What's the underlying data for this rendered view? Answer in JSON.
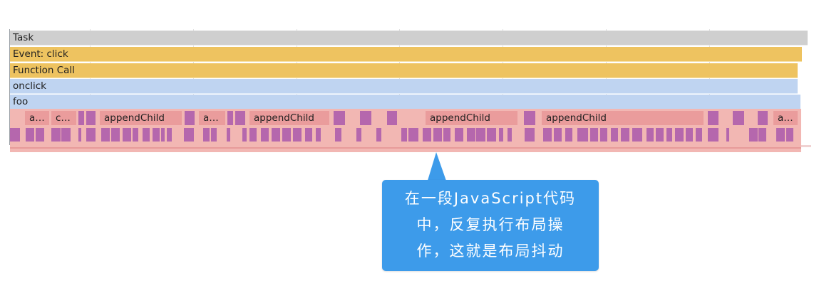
{
  "rows": {
    "task": "Task",
    "event": "Event: click",
    "function_call": "Function Call",
    "onclick": "onclick",
    "foo": "foo"
  },
  "call_labels": {
    "a1": "a…",
    "c1": "c…",
    "append1": "appendChild",
    "a2": "a…",
    "append2": "appendChild",
    "append3": "appendChild",
    "append4": "appendChild",
    "a3": "a…"
  },
  "callout": {
    "line1": "在一段JavaScript代码",
    "line2": "中，反复执行布局操",
    "line3": "作，这就是布局抖动"
  },
  "colors": {
    "task": "#cfcfcf",
    "event": "#eec360",
    "script": "#bfd4f1",
    "layout_band": "#f2b7b3",
    "layout_block": "#b567ad",
    "callout": "#3d9bea"
  }
}
